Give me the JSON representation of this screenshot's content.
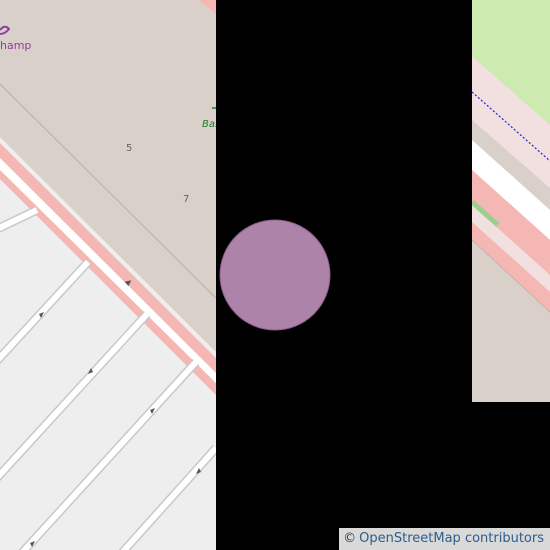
{
  "map": {
    "labels": {
      "poi_partial": "hamp",
      "green_partial": "Bas",
      "house_number_5": "5",
      "house_number_7": "7"
    },
    "colors": {
      "background": "#000000",
      "building_area": "#d9d0c9",
      "road_casing": "#f4b7b3",
      "road_fill": "#ffffff",
      "parking": "#eeeeee",
      "park": "#cdebb0",
      "pedestrian": "#f2dfe0",
      "poi_marker": "#ad83aa",
      "poi_text": "#8e3fa0",
      "green_text": "#168227"
    }
  },
  "attribution": {
    "copyright_symbol": "©",
    "text": "OpenStreetMap contributors"
  }
}
